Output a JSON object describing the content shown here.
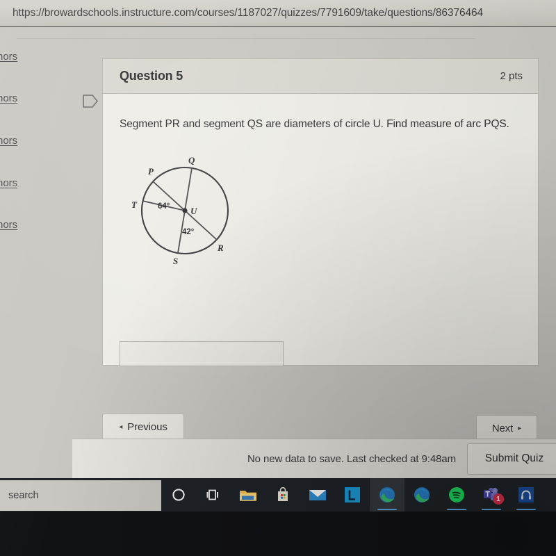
{
  "browser": {
    "url": "https://browardschools.instructure.com/courses/1187027/quizzes/7791609/take/questions/86376464"
  },
  "left_nav": {
    "items": [
      {
        "label": "nors"
      },
      {
        "label": "nors"
      },
      {
        "label": "nors"
      },
      {
        "label": "nors"
      },
      {
        "label": "nors"
      }
    ]
  },
  "question": {
    "flag_icon": "flag-tag-icon",
    "title": "Question 5",
    "points": "2 pts",
    "text": "Segment PR and segment QS are diameters of circle U. Find measure of arc PQS.",
    "answer_value": "",
    "answer_placeholder": ""
  },
  "figure": {
    "description": "Circle U with diameters PR and QS, plus radius UT",
    "center_label": "U",
    "points": [
      {
        "label": "P"
      },
      {
        "label": "Q"
      },
      {
        "label": "T"
      },
      {
        "label": "S"
      },
      {
        "label": "R"
      }
    ],
    "angles": [
      {
        "label": "64°",
        "between": "P-U-T"
      },
      {
        "label": "42°",
        "between": "S-U-R"
      }
    ]
  },
  "navigation": {
    "previous_label": "Previous",
    "previous_caret": "◂",
    "next_label": "Next",
    "next_caret": "▸"
  },
  "status_bar": {
    "save_text": "No new data to save. Last checked at 9:48am",
    "submit_label": "Submit Quiz"
  },
  "taskbar": {
    "search_placeholder": "search",
    "items": [
      {
        "name": "cortana-icon",
        "label": "Cortana"
      },
      {
        "name": "task-view-icon",
        "label": "Task View"
      },
      {
        "name": "file-explorer-icon",
        "label": "File Explorer"
      },
      {
        "name": "microsoft-store-icon",
        "label": "Microsoft Store"
      },
      {
        "name": "mail-icon",
        "label": "Mail"
      },
      {
        "name": "lanschool-icon",
        "label": "L"
      },
      {
        "name": "edge-icon",
        "label": "Microsoft Edge"
      },
      {
        "name": "edge-icon",
        "label": "Microsoft Edge"
      },
      {
        "name": "spotify-icon",
        "label": "Spotify"
      },
      {
        "name": "teams-icon",
        "label": "Microsoft Teams",
        "badge": "1"
      },
      {
        "name": "headset-app-icon",
        "label": "Headset App"
      }
    ]
  },
  "colors": {
    "page_background": "#c9c7c1",
    "card_background": "#eeede7",
    "card_header": "#d9d7cf",
    "taskbar": "#1f2328",
    "accent_underline": "#5aa9e6",
    "badge_red": "#d8314b"
  }
}
